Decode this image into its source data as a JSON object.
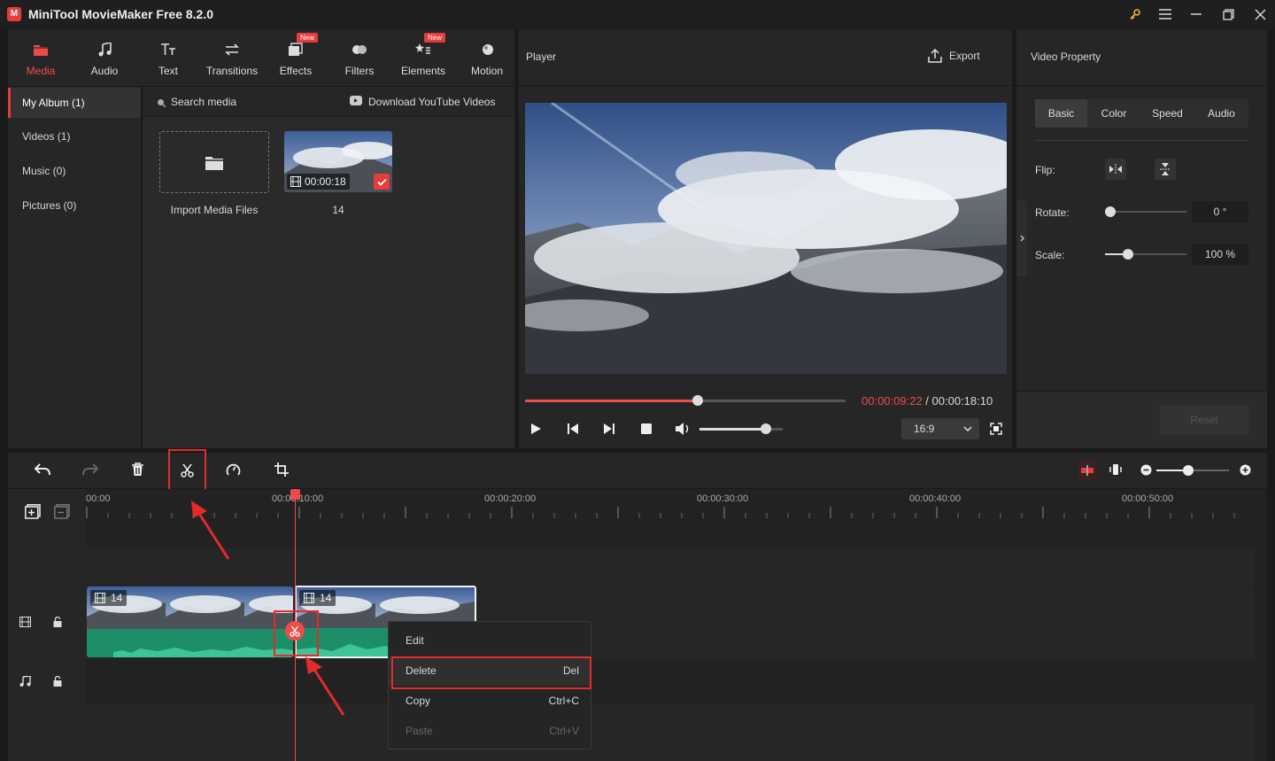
{
  "app": {
    "title": "MiniTool MovieMaker Free 8.2.0"
  },
  "categories": [
    {
      "label": "Media",
      "icon": "media-folder-icon",
      "active": true
    },
    {
      "label": "Audio",
      "icon": "music-note-icon"
    },
    {
      "label": "Text",
      "icon": "text-icon"
    },
    {
      "label": "Transitions",
      "icon": "transitions-icon"
    },
    {
      "label": "Effects",
      "icon": "effects-icon",
      "badge": "New"
    },
    {
      "label": "Filters",
      "icon": "filters-icon"
    },
    {
      "label": "Elements",
      "icon": "elements-icon",
      "badge": "New"
    },
    {
      "label": "Motion",
      "icon": "motion-icon"
    }
  ],
  "albums": [
    "My Album (1)",
    "Videos (1)",
    "Music (0)",
    "Pictures (0)"
  ],
  "media": {
    "search_placeholder": "Search media",
    "download_label": "Download YouTube Videos",
    "import_label": "Import Media Files",
    "clip_duration": "00:00:18",
    "clip_name": "14"
  },
  "player": {
    "title": "Player",
    "export_label": "Export",
    "current_time": "00:00:09:22",
    "separator": " / ",
    "total_time": "00:00:18:10",
    "progress": 0.54,
    "volume": 0.8,
    "aspect": "16:9"
  },
  "property": {
    "title": "Video Property",
    "tabs": [
      "Basic",
      "Color",
      "Speed",
      "Audio"
    ],
    "flip_label": "Flip:",
    "rotate_label": "Rotate:",
    "rotate_value": "0 °",
    "scale_label": "Scale:",
    "scale_value": "100 %",
    "reset_label": "Reset"
  },
  "timeline": {
    "ticks": [
      "00:00",
      "00:00:10:00",
      "00:00:20:00",
      "00:00:30:00",
      "00:00:40:00",
      "00:00:50:00"
    ],
    "clip_label_1": "14",
    "clip_label_2": "14"
  },
  "context_menu": {
    "items": [
      {
        "label": "Edit",
        "shortcut": ""
      },
      {
        "label": "Delete",
        "shortcut": "Del"
      },
      {
        "label": "Copy",
        "shortcut": "Ctrl+C"
      },
      {
        "label": "Paste",
        "shortcut": "Ctrl+V"
      }
    ]
  }
}
